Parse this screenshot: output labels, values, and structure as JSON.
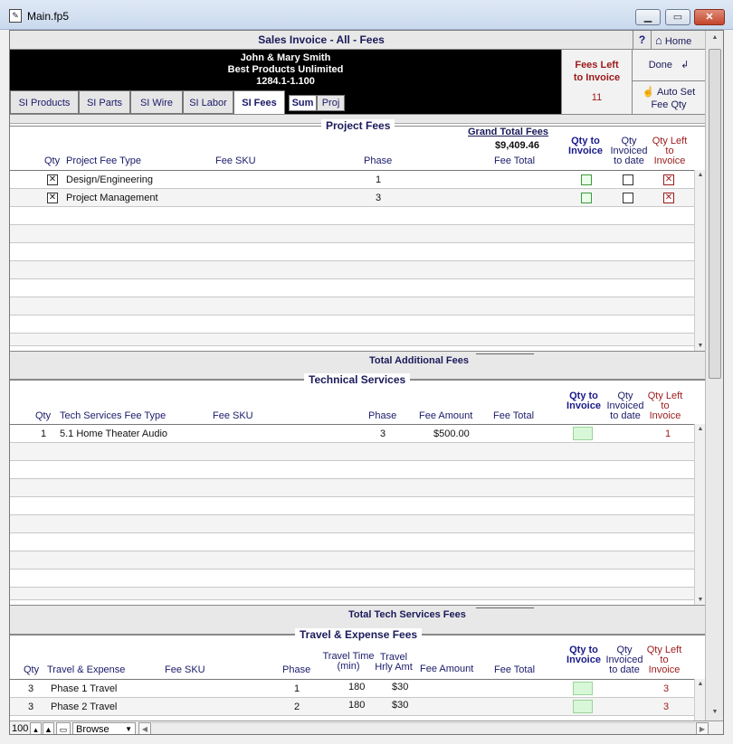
{
  "window": {
    "title": "Main.fp5",
    "min_icon": "minimize-icon",
    "max_icon": "maximize-icon",
    "close_icon": "close-icon"
  },
  "header": {
    "title": "Sales Invoice - All - Fees",
    "help_label": "?",
    "home_label": "Home",
    "client_name": "John & Mary Smith",
    "company": "Best Products Unlimited",
    "invoice_id": "1284.1-1.100",
    "fees_left_label_1": "Fees Left",
    "fees_left_label_2": "to Invoice",
    "fees_left_count": "11",
    "done_label": "Done",
    "autoset_label_1": "Auto Set",
    "autoset_label_2": "Fee Qty"
  },
  "tabs": [
    {
      "label": "SI Products"
    },
    {
      "label": "SI Parts"
    },
    {
      "label": "SI Wire"
    },
    {
      "label": "SI Labor"
    },
    {
      "label": "SI Fees",
      "active": true
    }
  ],
  "subtabs": [
    {
      "label": "Sum",
      "active": true
    },
    {
      "label": "Proj"
    }
  ],
  "project_fees": {
    "title": "Project Fees",
    "grand_total_label": "Grand Total Fees",
    "grand_total_value": "$9,409.46",
    "columns": {
      "qty": "Qty",
      "type": "Project Fee Type",
      "sku": "Fee SKU",
      "phase": "Phase",
      "fee_total": "Fee Total",
      "qty_to_invoice": "Qty to Invoice",
      "qty_invoiced": "Qty Invoiced to date",
      "qty_left": "Qty Left to Invoice"
    },
    "rows": [
      {
        "type": "Design/Engineering",
        "phase": "1"
      },
      {
        "type": "Project Management",
        "phase": "3"
      }
    ],
    "total_label": "Total Additional Fees"
  },
  "tech_services": {
    "title": "Technical Services",
    "columns": {
      "qty": "Qty",
      "type": "Tech Services Fee Type",
      "sku": "Fee SKU",
      "phase": "Phase",
      "fee_amount": "Fee Amount",
      "fee_total": "Fee Total",
      "qty_to_invoice": "Qty to Invoice",
      "qty_invoiced": "Qty Invoiced to date",
      "qty_left": "Qty Left to Invoice"
    },
    "rows": [
      {
        "qty": "1",
        "type": "5.1 Home Theater Audio",
        "phase": "3",
        "fee_amount": "$500.00",
        "qty_left": "1"
      }
    ],
    "total_label": "Total Tech Services Fees"
  },
  "travel": {
    "title": "Travel & Expense Fees",
    "columns": {
      "qty": "Qty",
      "type": "Travel & Expense",
      "sku": "Fee SKU",
      "phase": "Phase",
      "travel_time": "Travel Time (min)",
      "hrly_amt": "Travel Hrly Amt",
      "fee_amount": "Fee Amount",
      "fee_total": "Fee Total",
      "qty_to_invoice": "Qty to Invoice",
      "qty_invoiced": "Qty Invoiced to date",
      "qty_left": "Qty Left to Invoice"
    },
    "rows": [
      {
        "qty": "3",
        "type": "Phase 1 Travel",
        "phase": "1",
        "time": "180",
        "rate": "$30",
        "qty_left": "3"
      },
      {
        "qty": "3",
        "type": "Phase 2 Travel",
        "phase": "2",
        "time": "180",
        "rate": "$30",
        "qty_left": "3"
      }
    ]
  },
  "statusbar": {
    "zoom": "100",
    "mode": "Browse"
  }
}
